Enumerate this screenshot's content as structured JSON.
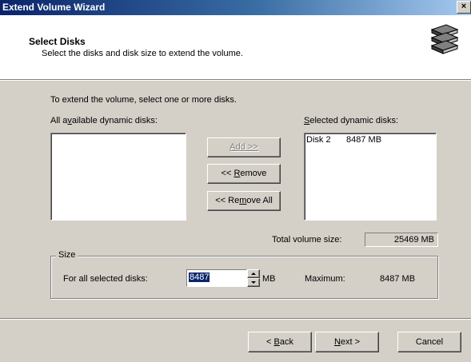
{
  "window": {
    "title": "Extend Volume Wizard",
    "close_glyph": "×"
  },
  "header": {
    "title": "Select Disks",
    "subtitle": "Select the disks and disk size to extend the volume.",
    "icon": "disk-stack-icon"
  },
  "intro": "To extend the volume, select one or more disks.",
  "available": {
    "label_pre": "All a",
    "label_u": "v",
    "label_post": "ailable dynamic disks:",
    "items": []
  },
  "selected": {
    "label_u": "S",
    "label_post": "elected dynamic disks:",
    "items": [
      {
        "name": "Disk 2",
        "size": "8487 MB"
      }
    ]
  },
  "buttons": {
    "add": "Add >>",
    "remove_pre": "<< ",
    "remove_u": "R",
    "remove_post": "emove",
    "removeall_pre": "<< Re",
    "removeall_u": "m",
    "removeall_post": "ove All"
  },
  "total": {
    "label": "Total volume size:",
    "value": "25469 MB"
  },
  "size": {
    "group_label": "Size",
    "for_all_label": "For all selected disks:",
    "value": "8487",
    "unit": "MB",
    "max_label": "Maximum:",
    "max_value": "8487 MB"
  },
  "footer": {
    "back_pre": "< ",
    "back_u": "B",
    "back_post": "ack",
    "next_u": "N",
    "next_post": "ext >",
    "cancel": "Cancel"
  }
}
